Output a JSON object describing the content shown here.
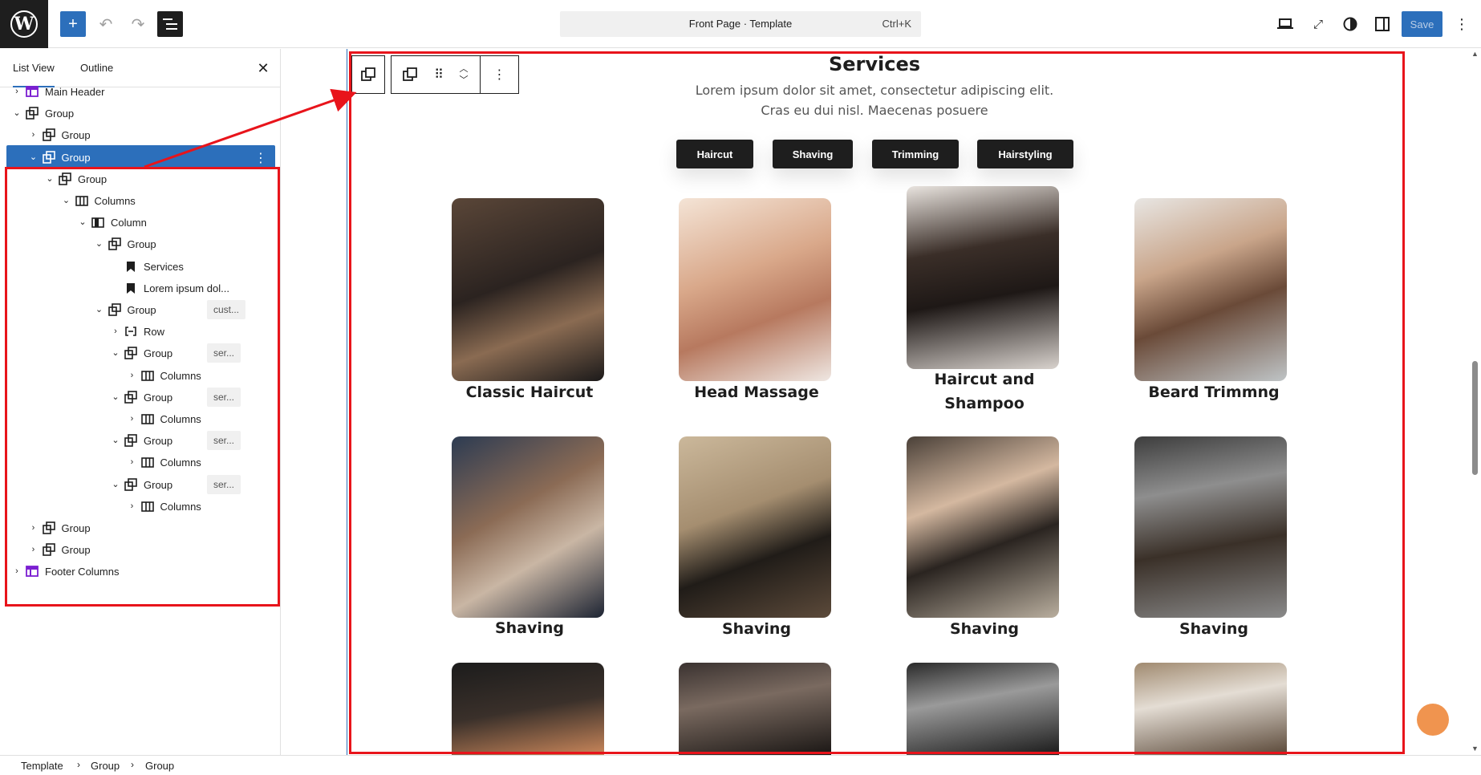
{
  "topbar": {
    "command_title": "Front Page · Template",
    "command_shortcut": "Ctrl+K",
    "save_label": "Save"
  },
  "sidebar": {
    "tabs": [
      "List View",
      "Outline"
    ],
    "tree": [
      {
        "label": "Main Header",
        "badge": ""
      },
      {
        "label": "Group",
        "badge": ""
      },
      {
        "label": "Group",
        "badge": ""
      },
      {
        "label": "Group",
        "badge": ""
      },
      {
        "label": "Group",
        "badge": ""
      },
      {
        "label": "Columns",
        "badge": ""
      },
      {
        "label": "Column",
        "badge": ""
      },
      {
        "label": "Group",
        "badge": ""
      },
      {
        "label": "Services",
        "badge": ""
      },
      {
        "label": "Lorem ipsum dol...",
        "badge": ""
      },
      {
        "label": "Group",
        "badge": "cust..."
      },
      {
        "label": "Row",
        "badge": ""
      },
      {
        "label": "Group",
        "badge": "ser..."
      },
      {
        "label": "Columns",
        "badge": ""
      },
      {
        "label": "Group",
        "badge": "ser..."
      },
      {
        "label": "Columns",
        "badge": ""
      },
      {
        "label": "Group",
        "badge": "ser..."
      },
      {
        "label": "Columns",
        "badge": ""
      },
      {
        "label": "Group",
        "badge": "ser..."
      },
      {
        "label": "Columns",
        "badge": ""
      },
      {
        "label": "Group",
        "badge": ""
      },
      {
        "label": "Group",
        "badge": ""
      },
      {
        "label": "Footer Columns",
        "badge": ""
      }
    ]
  },
  "canvas": {
    "title": "Services",
    "desc_line1": "Lorem ipsum dolor sit amet, consectetur adipiscing elit.",
    "desc_line2": "Cras eu dui nisl. Maecenas posuere",
    "pills": [
      "Haircut",
      "Shaving",
      "Trimming",
      "Hairstyling"
    ],
    "cards": [
      {
        "title": "Classic Haircut"
      },
      {
        "title": "Head Massage"
      },
      {
        "title": "Haircut and Shampoo"
      },
      {
        "title": "Beard Trimmng"
      },
      {
        "title": "Shaving"
      },
      {
        "title": "Shaving"
      },
      {
        "title": "Shaving"
      },
      {
        "title": "Shaving"
      },
      {
        "title": ""
      },
      {
        "title": ""
      },
      {
        "title": ""
      },
      {
        "title": ""
      }
    ]
  },
  "breadcrumb": [
    "Template",
    "Group",
    "Group"
  ],
  "colors": {
    "accent": "#2c6fbb",
    "highlight": "#e8141b",
    "fab": "#f0944f"
  }
}
